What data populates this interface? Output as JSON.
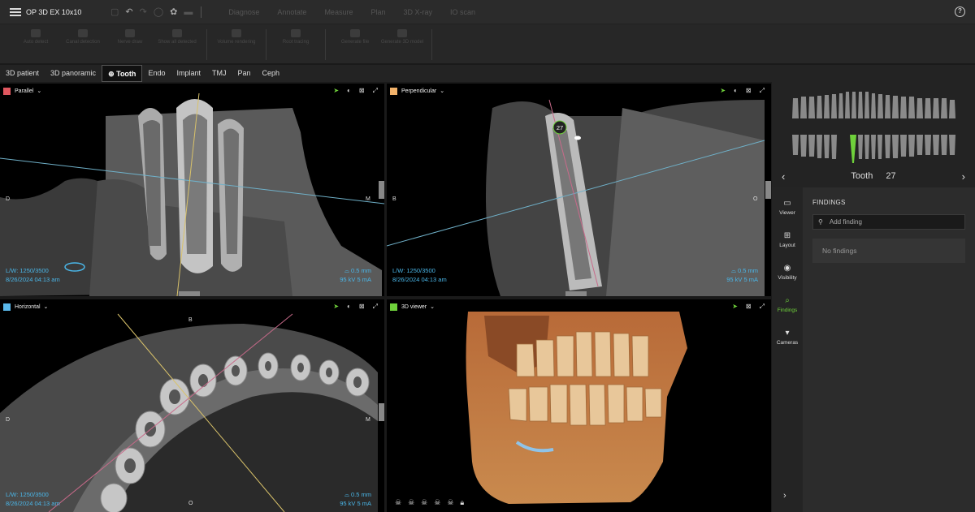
{
  "app": {
    "title": "OP 3D EX 10x10"
  },
  "toolbar": {
    "icons": [
      "save-icon",
      "undo-icon",
      "redo-icon",
      "circle-icon",
      "settings-icon",
      "line-icon"
    ],
    "tabs": [
      "Diagnose",
      "Annotate",
      "Measure",
      "Plan",
      "3D X-ray",
      "IO scan"
    ]
  },
  "ribbon": {
    "groups": [
      [
        {
          "label": "Auto detect"
        },
        {
          "label": "Canal detection"
        },
        {
          "label": "Nerve draw"
        },
        {
          "label": "Show all detected"
        }
      ],
      [
        {
          "label": "Volume rendering"
        }
      ],
      [
        {
          "label": "Root tracing"
        }
      ],
      [
        {
          "label": "Generate file"
        },
        {
          "label": "Generate 3D model"
        }
      ]
    ]
  },
  "subtabs": [
    "3D patient",
    "3D panoramic",
    "Tooth",
    "Endo",
    "Implant",
    "TMJ",
    "Pan",
    "Ceph"
  ],
  "active_subtab": "Tooth",
  "viewports": {
    "parallel": {
      "title": "Parallel",
      "color": "#e0575f",
      "left": "D",
      "right": "M",
      "lw": "L/W: 1250/3500",
      "date": "8/26/2024 04:13 am",
      "slice": "0.5 mm",
      "kv": "95 kV  5 mA"
    },
    "perpendicular": {
      "title": "Perpendicular",
      "color": "#f2b26a",
      "left": "B",
      "right": "O",
      "lw": "L/W: 1250/3500",
      "date": "8/26/2024 04:13 am",
      "slice": "0.5 mm",
      "kv": "95 kV  5 mA",
      "tooth_marker": "27"
    },
    "horizontal": {
      "title": "Horizontal",
      "color": "#5ab8ea",
      "top": "B",
      "left": "D",
      "right": "M",
      "bottom": "O",
      "lw": "L/W: 1250/3500",
      "date": "8/26/2024 04:13 am",
      "slice": "0.5 mm",
      "kv": "95 kV  5 mA"
    },
    "viewer3d": {
      "title": "3D viewer",
      "color": "#6fd13b"
    }
  },
  "side": {
    "tooth_label": "Tooth",
    "tooth_number": "27",
    "rail": [
      {
        "label": "Viewer",
        "icon": "viewer-icon"
      },
      {
        "label": "Layout",
        "icon": "layout-icon"
      },
      {
        "label": "Visibility",
        "icon": "eye-icon"
      },
      {
        "label": "Findings",
        "icon": "findings-icon"
      },
      {
        "label": "Cameras",
        "icon": "camera-icon"
      }
    ],
    "findings_title": "FINDINGS",
    "add_placeholder": "Add finding",
    "no_findings": "No findings"
  }
}
